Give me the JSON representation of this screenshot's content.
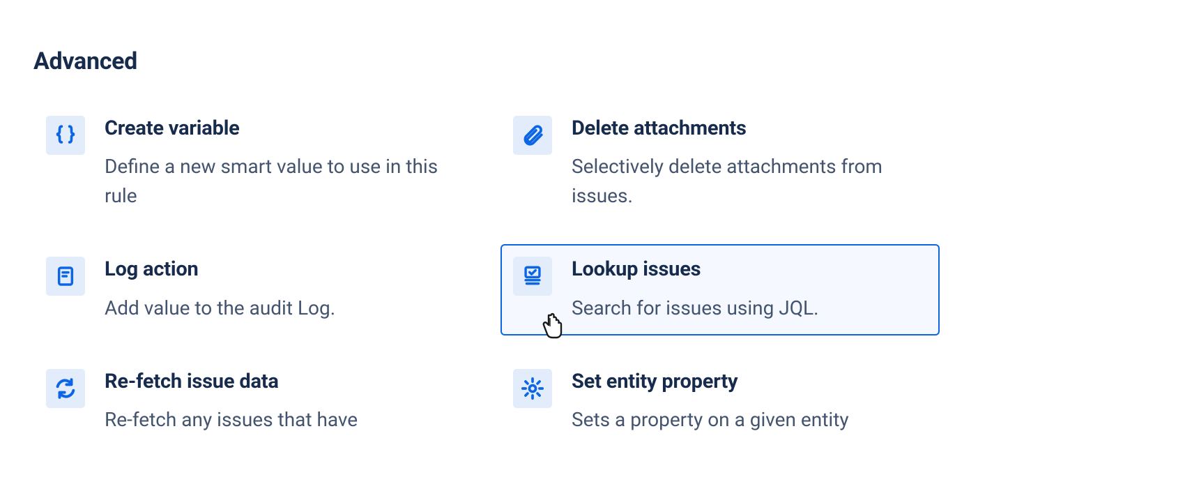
{
  "section_title": "Advanced",
  "items": [
    {
      "id": "create-variable",
      "title": "Create variable",
      "desc": "Define a new smart value to use in this rule",
      "icon": "braces-icon",
      "selected": false
    },
    {
      "id": "delete-attachments",
      "title": "Delete attachments",
      "desc": "Selectively delete attachments from issues.",
      "icon": "paperclip-icon",
      "selected": false
    },
    {
      "id": "log-action",
      "title": "Log action",
      "desc": "Add value to the audit Log.",
      "icon": "document-icon",
      "selected": false
    },
    {
      "id": "lookup-issues",
      "title": "Lookup issues",
      "desc": "Search for issues using JQL.",
      "icon": "stack-check-icon",
      "selected": true
    },
    {
      "id": "re-fetch-issue-data",
      "title": "Re-fetch issue data",
      "desc": "Re-fetch any issues that have",
      "icon": "refresh-icon",
      "selected": false
    },
    {
      "id": "set-entity-property",
      "title": "Set entity property",
      "desc": "Sets a property on a given entity",
      "icon": "gear-icon",
      "selected": false
    }
  ]
}
